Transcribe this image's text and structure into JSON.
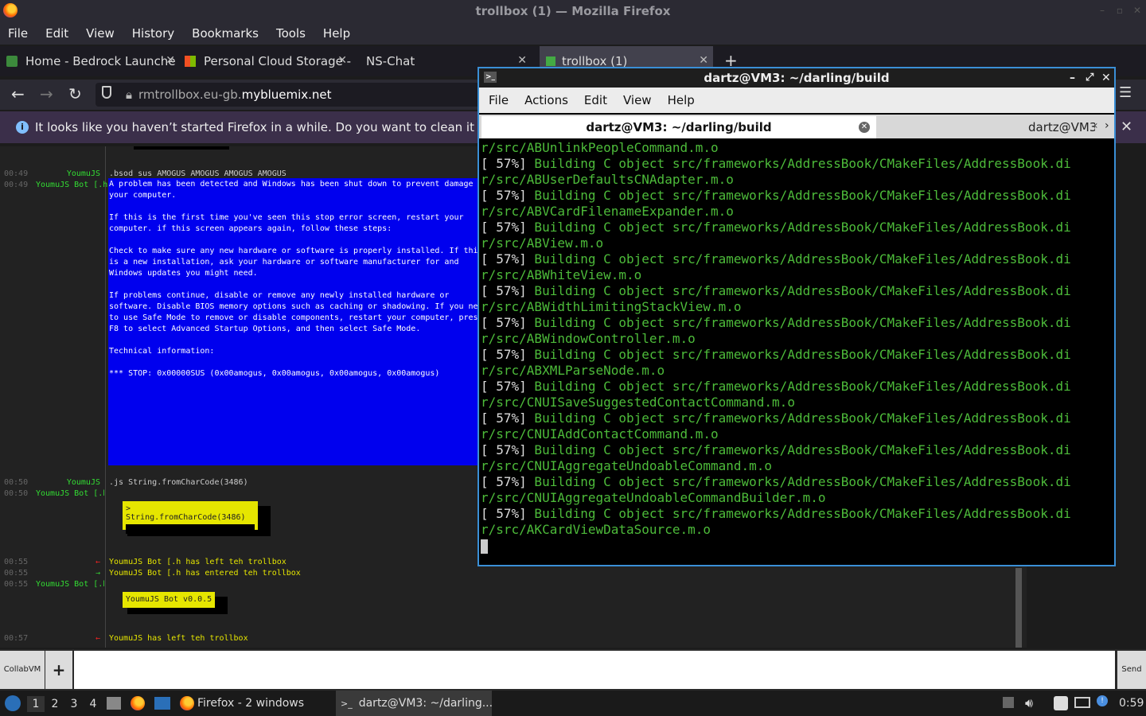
{
  "firefox": {
    "window_title": "trollbox (1) — Mozilla Firefox",
    "menu": [
      "File",
      "Edit",
      "View",
      "History",
      "Bookmarks",
      "Tools",
      "Help"
    ],
    "tabs": [
      {
        "label": "Home - Bedrock Launche"
      },
      {
        "label": "Personal Cloud Storage -"
      },
      {
        "label": "NS-Chat"
      },
      {
        "label": "trollbox (1)"
      }
    ],
    "url": {
      "host": "rmtrollbox.eu-gb.",
      "domain": "mybluemix.net"
    },
    "notice": "It looks like you haven’t started Firefox in a while. Do you want to clean it up for a f"
  },
  "chat": {
    "lines": [
      {
        "time": "00:49",
        "nick": "YoumuJS",
        "text": ".bsod sus AMOGUS AMOGUS AMOGUS AMOGUS"
      },
      {
        "time": "00:49",
        "nick": "YoumuJS Bot [.h]",
        "text": ""
      },
      {
        "time": "00:50",
        "nick": "YoumuJS",
        "text": ".js String.fromCharCode(3486)"
      },
      {
        "time": "00:50",
        "nick": "YoumuJS Bot [.h]",
        "text": ""
      },
      {
        "time": "00:55",
        "nick": "",
        "text": "YoumuJS Bot [.h has left teh trollbox"
      },
      {
        "time": "00:55",
        "nick": "",
        "text": "YoumuJS Bot [.h has entered teh trollbox"
      },
      {
        "time": "00:55",
        "nick": "YoumuJS Bot [.h]",
        "text": ""
      },
      {
        "time": "00:57",
        "nick": "",
        "text": "YoumuJS has left teh trollbox"
      }
    ],
    "bsod_text": "A problem has been detected and Windows has been shut down to prevent damage\nyour computer.\n\nIf this is the first time you've seen this stop error screen, restart your\ncomputer. if this screen appears again, follow these steps:\n\nCheck to make sure any new hardware or software is properly installed. If thi\nis a new installation, ask your hardware or software manufacturer for and\nWindows updates you might need.\n\nIf problems continue, disable or remove any newly installed hardware or\nsoftware. Disable BIOS memory options such as caching or shadowing. If you ne\nto use Safe Mode to remove or disable components, restart your computer, pres\nF8 to select Advanced Startup Options, and then select Safe Mode.\n\nTechnical information:\n\n*** STOP: 0x00000SUS (0x00amogus, 0x00amogus, 0x00amogus, 0x00amogus)",
    "js_result": "> String.fromCharCode(3486)",
    "bot_version": "YoumuJS Bot v0.0.5",
    "collab_label": "CollabVM",
    "plus_label": "+",
    "send_label": "Send"
  },
  "terminal": {
    "title": "dartz@VM3: ~/darling/build",
    "menu": [
      "File",
      "Actions",
      "Edit",
      "View",
      "Help"
    ],
    "tab_active": "dartz@VM3: ~/darling/build",
    "tab_other": "dartz@VM3",
    "lines": [
      "r/src/ABUnlinkPeopleCommand.m.o",
      "[ 57%] Building C object src/frameworks/AddressBook/CMakeFiles/AddressBook.di",
      "r/src/ABUserDefaultsCNAdapter.m.o",
      "[ 57%] Building C object src/frameworks/AddressBook/CMakeFiles/AddressBook.di",
      "r/src/ABVCardFilenameExpander.m.o",
      "[ 57%] Building C object src/frameworks/AddressBook/CMakeFiles/AddressBook.di",
      "r/src/ABView.m.o",
      "[ 57%] Building C object src/frameworks/AddressBook/CMakeFiles/AddressBook.di",
      "r/src/ABWhiteView.m.o",
      "[ 57%] Building C object src/frameworks/AddressBook/CMakeFiles/AddressBook.di",
      "r/src/ABWidthLimitingStackView.m.o",
      "[ 57%] Building C object src/frameworks/AddressBook/CMakeFiles/AddressBook.di",
      "r/src/ABWindowController.m.o",
      "[ 57%] Building C object src/frameworks/AddressBook/CMakeFiles/AddressBook.di",
      "r/src/ABXMLParseNode.m.o",
      "[ 57%] Building C object src/frameworks/AddressBook/CMakeFiles/AddressBook.di",
      "r/src/CNUISaveSuggestedContactCommand.m.o",
      "[ 57%] Building C object src/frameworks/AddressBook/CMakeFiles/AddressBook.di",
      "r/src/CNUIAddContactCommand.m.o",
      "[ 57%] Building C object src/frameworks/AddressBook/CMakeFiles/AddressBook.di",
      "r/src/CNUIAggregateUndoableCommand.m.o",
      "[ 57%] Building C object src/frameworks/AddressBook/CMakeFiles/AddressBook.di",
      "r/src/CNUIAggregateUndoableCommandBuilder.m.o",
      "[ 57%] Building C object src/frameworks/AddressBook/CMakeFiles/AddressBook.di",
      "r/src/AKCardViewDataSource.m.o"
    ]
  },
  "taskbar": {
    "workspaces": [
      "1",
      "2",
      "3",
      "4"
    ],
    "firefox_group": "Firefox - 2 windows",
    "terminal_task": "dartz@VM3: ~/darling...",
    "clock": "0:59"
  },
  "colors": {
    "terminal_green": "#4dbb3a",
    "bsod_blue": "#0000ee",
    "accent": "#3a8fd6"
  }
}
